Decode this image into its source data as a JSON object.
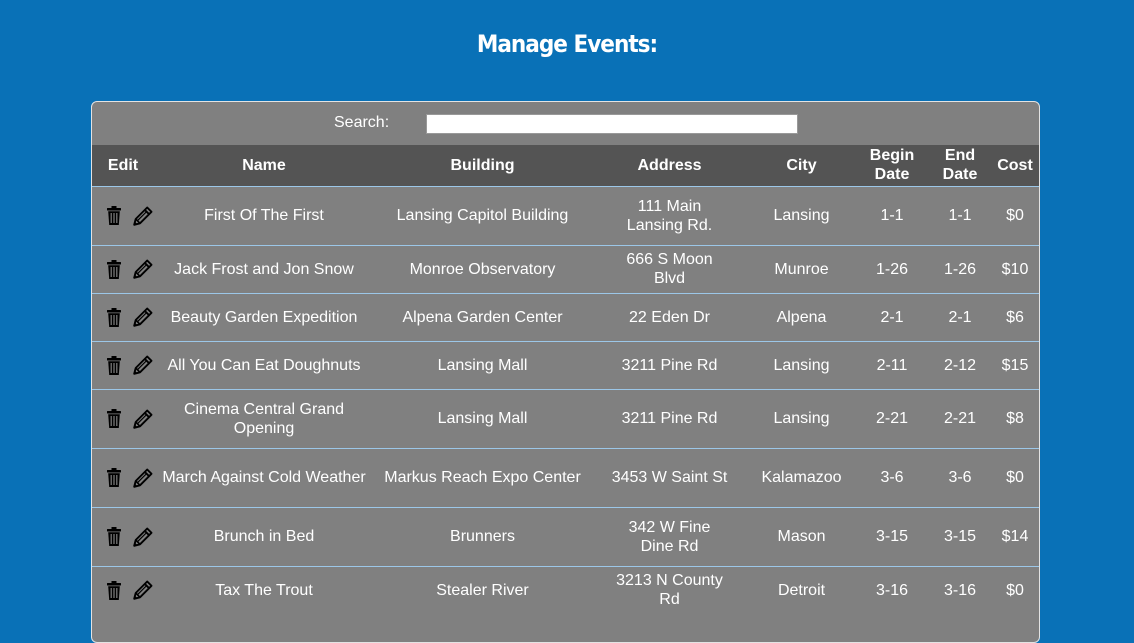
{
  "page": {
    "title": "Manage Events:"
  },
  "search": {
    "label": "Search:",
    "value": "",
    "placeholder": ""
  },
  "table": {
    "headers": {
      "edit": "Edit",
      "name": "Name",
      "building": "Building",
      "address": "Address",
      "city": "City",
      "begin_date": "Begin Date",
      "end_date": "End Date",
      "cost": "Cost"
    },
    "rows": [
      {
        "name": "First Of The First",
        "building": "Lansing Capitol Building",
        "address": "111 Main Lansing Rd.",
        "city": "Lansing",
        "begin": "1-1",
        "end": "1-1",
        "cost": "$0"
      },
      {
        "name": "Jack Frost and Jon Snow",
        "building": "Monroe Observatory",
        "address": "666 S Moon Blvd",
        "city": "Munroe",
        "begin": "1-26",
        "end": "1-26",
        "cost": "$10"
      },
      {
        "name": "Beauty Garden Expedition",
        "building": "Alpena Garden Center",
        "address": "22 Eden Dr",
        "city": "Alpena",
        "begin": "2-1",
        "end": "2-1",
        "cost": "$6"
      },
      {
        "name": "All You Can Eat Doughnuts",
        "building": "Lansing Mall",
        "address": "3211 Pine Rd",
        "city": "Lansing",
        "begin": "2-11",
        "end": "2-12",
        "cost": "$15"
      },
      {
        "name": "Cinema Central Grand Opening",
        "building": "Lansing Mall",
        "address": "3211 Pine Rd",
        "city": "Lansing",
        "begin": "2-21",
        "end": "2-21",
        "cost": "$8"
      },
      {
        "name": "March Against Cold Weather",
        "building": "Markus Reach Expo Center",
        "address": "3453 W Saint St",
        "city": "Kalamazoo",
        "begin": "3-6",
        "end": "3-6",
        "cost": "$0"
      },
      {
        "name": "Brunch in Bed",
        "building": "Brunners",
        "address": "342 W Fine Dine Rd",
        "city": "Mason",
        "begin": "3-15",
        "end": "3-15",
        "cost": "$14"
      },
      {
        "name": "Tax The Trout",
        "building": "Stealer River",
        "address": "3213 N County Rd",
        "city": "Detroit",
        "begin": "3-16",
        "end": "3-16",
        "cost": "$0"
      }
    ]
  }
}
